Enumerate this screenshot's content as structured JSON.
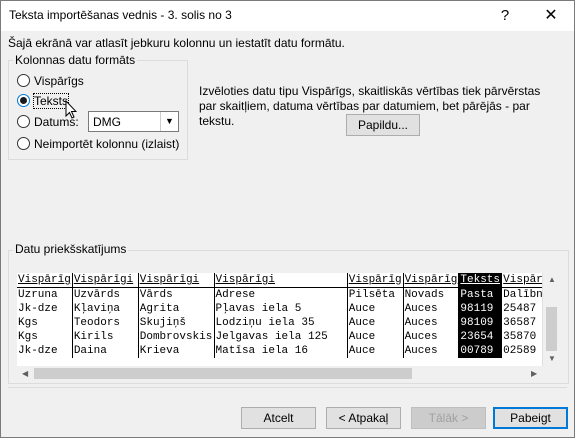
{
  "window": {
    "title": "Teksta importēšanas vednis - 3. solis no 3",
    "help": "?",
    "close": "✕"
  },
  "intro": "Šajā ekrānā var atlasīt jebkuru kolonnu un iestatīt datu formātu.",
  "column_format": {
    "label": "Kolonnas datu formāts",
    "options": [
      {
        "label": "Vispārīgs",
        "checked": false
      },
      {
        "label": "Teksts",
        "checked": true
      },
      {
        "label": "Datums:",
        "checked": false
      },
      {
        "label": "Neimportēt kolonnu (izlaist)",
        "checked": false
      }
    ],
    "date_format": "DMG"
  },
  "description": "Izvēloties datu tipu Vispārīgs, skaitliskās vērtības tiek pārvērstas par skaitļiem, datuma vērtības par datumiem, bet pārējās - par tekstu.",
  "advanced_button": "Papildu...",
  "preview": {
    "label": "Datu priekšskatījums",
    "headers": [
      "Vispārīg",
      "Vispārīgi",
      "Vispārīgi",
      "Vispārīgi",
      "Vispārīg",
      "Vispārīg",
      "Teksts",
      "Vispārīg"
    ],
    "rows": [
      [
        "Uzruna",
        "Uzvārds",
        "Vārds",
        "Adrese",
        "Pilsēta",
        "Novads",
        "Pasta",
        "Dalībn"
      ],
      [
        "Jk-dze",
        "Kļaviņa",
        "Agrita",
        "Pļavas iela 5",
        "Auce",
        "Auces",
        "98119",
        "25487"
      ],
      [
        "Kgs",
        "Teodors",
        "Skujiņš",
        "Lodziņu iela 35",
        "Auce",
        "Auces",
        "98109",
        "36587"
      ],
      [
        "Kgs",
        "Kirils",
        "Dombrovskis",
        "Jelgavas iela 125",
        "Auce",
        "Auces",
        "23654",
        "35870"
      ],
      [
        "Jk-dze",
        "Daina",
        "Krieva",
        "Matīsa iela 16",
        "Auce",
        "Auces",
        "00789",
        "02589"
      ]
    ],
    "selected_column": 6
  },
  "buttons": {
    "cancel": "Atcelt",
    "back": "< Atpakaļ",
    "next": "Tālāk >",
    "finish": "Pabeigt"
  }
}
